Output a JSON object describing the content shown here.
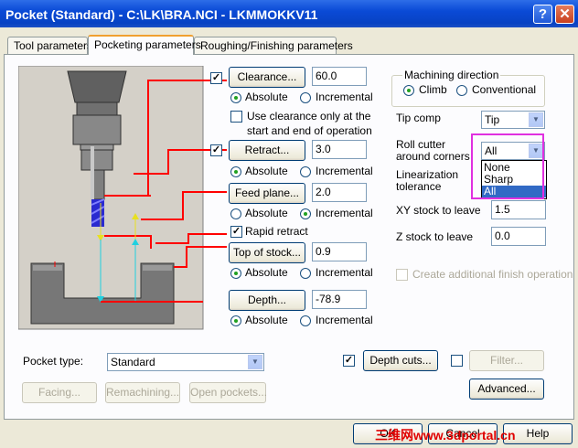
{
  "window": {
    "title": "Pocket (Standard) - C:\\LK\\BRA.NCI - LKMMOKKV11",
    "help_glyph": "?",
    "close_glyph": "✕"
  },
  "tabs": [
    {
      "label": "Tool parameters"
    },
    {
      "label": "Pocketing parameters"
    },
    {
      "label": "Roughing/Finishing parameters"
    }
  ],
  "params": {
    "clearance": {
      "label": "Clearance...",
      "value": "60.0",
      "checked": true,
      "absolute": "Absolute",
      "incremental": "Incremental",
      "mode": "absolute"
    },
    "clearance_only_text1": "Use clearance only at the",
    "clearance_only_text2": "start and end of operation",
    "retract": {
      "label": "Retract...",
      "value": "3.0",
      "checked": true,
      "absolute": "Absolute",
      "incremental": "Incremental",
      "mode": "absolute"
    },
    "feed_plane": {
      "label": "Feed plane...",
      "value": "2.0",
      "absolute": "Absolute",
      "incremental": "Incremental",
      "mode": "incremental"
    },
    "rapid_retract": {
      "label": "Rapid retract",
      "checked": true
    },
    "top_of_stock": {
      "label": "Top of stock...",
      "value": "0.9",
      "absolute": "Absolute",
      "incremental": "Incremental",
      "mode": "absolute"
    },
    "depth": {
      "label": "Depth...",
      "value": "-78.9",
      "absolute": "Absolute",
      "incremental": "Incremental",
      "mode": "absolute"
    }
  },
  "machining_direction": {
    "title": "Machining direction",
    "climb": "Climb",
    "conventional": "Conventional",
    "selected": "climb"
  },
  "tip_comp": {
    "label": "Tip comp",
    "value": "Tip"
  },
  "roll_cutter": {
    "label1": "Roll cutter",
    "label2": "around corners",
    "value": "All",
    "options": [
      "None",
      "Sharp",
      "All"
    ]
  },
  "linearization": {
    "label1": "Linearization",
    "label2": "tolerance"
  },
  "xy_stock": {
    "label": "XY stock to leave",
    "value": "1.5"
  },
  "z_stock": {
    "label": "Z stock to leave",
    "value": "0.0"
  },
  "create_finish": {
    "label": "Create additional finish operation"
  },
  "pocket_type": {
    "label": "Pocket type:",
    "value": "Standard"
  },
  "depth_cuts": {
    "label": "Depth cuts..."
  },
  "filter": {
    "label": "Filter..."
  },
  "facing": {
    "label": "Facing..."
  },
  "remachining": {
    "label": "Remachining..."
  },
  "open_pockets": {
    "label": "Open pockets..."
  },
  "advanced": {
    "label": "Advanced..."
  },
  "footer": {
    "ok": "OK",
    "cancel": "Cancel",
    "help": "Help"
  },
  "watermark": "三维网www.3dportal.cn",
  "colors": {
    "accent_red": "#ff0000",
    "arrow_yellow": "#e8e020",
    "arrow_cyan": "#20d0e0",
    "highlight": "#e030e0"
  }
}
